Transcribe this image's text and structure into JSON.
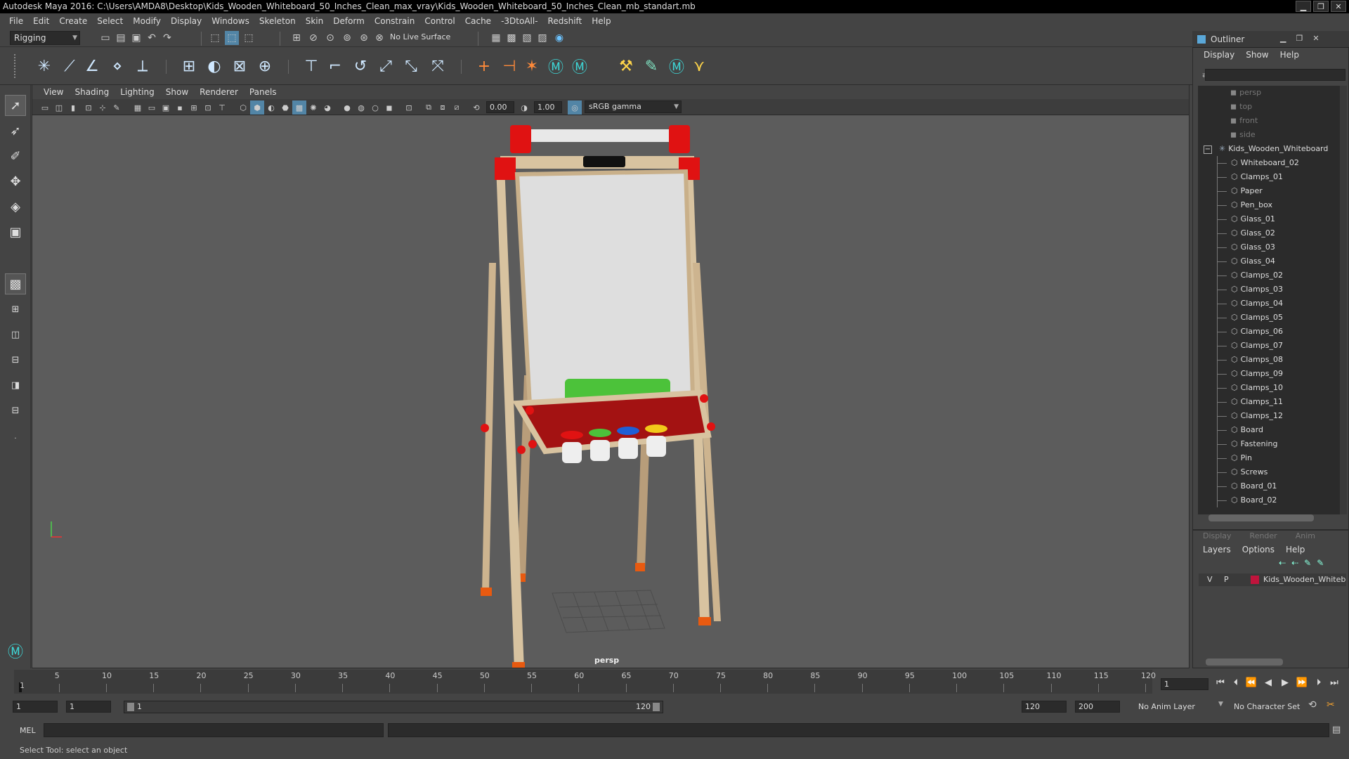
{
  "window": {
    "title": "Autodesk Maya 2016: C:\\Users\\AMDA8\\Desktop\\Kids_Wooden_Whiteboard_50_Inches_Clean_max_vray\\Kids_Wooden_Whiteboard_50_Inches_Clean_mb_standart.mb",
    "minimize": "▁",
    "restore": "❐",
    "close": "✕"
  },
  "menubar": [
    "File",
    "Edit",
    "Create",
    "Select",
    "Modify",
    "Display",
    "Windows",
    "Skeleton",
    "Skin",
    "Deform",
    "Constrain",
    "Control",
    "Cache",
    "-3DtoAll-",
    "Redshift",
    "Help"
  ],
  "statusline": {
    "menuset": "Rigging",
    "live_surface": "No Live Surface"
  },
  "panel": {
    "menus": [
      "View",
      "Shading",
      "Lighting",
      "Show",
      "Renderer",
      "Panels"
    ],
    "field_a": "0.00",
    "field_b": "1.00",
    "colorspace": "sRGB gamma",
    "camera": "persp"
  },
  "outliner": {
    "title": "Outliner",
    "menus": [
      "Display",
      "Show",
      "Help"
    ],
    "cameras": [
      "persp",
      "top",
      "front",
      "side"
    ],
    "group": "Kids_Wooden_Whiteboard",
    "collapse_glyph": "−",
    "items": [
      "Whiteboard_02",
      "Clamps_01",
      "Paper",
      "Pen_box",
      "Glass_01",
      "Glass_02",
      "Glass_03",
      "Glass_04",
      "Clamps_02",
      "Clamps_03",
      "Clamps_04",
      "Clamps_05",
      "Clamps_06",
      "Clamps_07",
      "Clamps_08",
      "Clamps_09",
      "Clamps_10",
      "Clamps_11",
      "Clamps_12",
      "Board",
      "Fastening",
      "Pin",
      "Screws",
      "Board_01",
      "Board_02"
    ]
  },
  "layers": {
    "tabs": [
      "Display",
      "Render",
      "Anim"
    ],
    "menus": [
      "Layers",
      "Options",
      "Help"
    ],
    "v": "V",
    "p": "P",
    "layer_name": "Kids_Wooden_Whiteb",
    "layer_color": "#c0143c"
  },
  "timeline": {
    "ticks": [
      "5",
      "10",
      "15",
      "20",
      "25",
      "30",
      "35",
      "40",
      "45",
      "50",
      "55",
      "60",
      "65",
      "70",
      "75",
      "80",
      "85",
      "90",
      "95",
      "100",
      "105",
      "110",
      "115",
      "120"
    ],
    "first_tick": "1",
    "current_frame": "1"
  },
  "range": {
    "start": "1",
    "anim_start": "1",
    "slider_start": "1",
    "slider_end": "120",
    "end": "120",
    "anim_end": "200",
    "anim_layer": "No Anim Layer",
    "char_set": "No Character Set"
  },
  "cmdline": {
    "label": "MEL"
  },
  "helpline": {
    "text": "Select Tool: select an object"
  },
  "colors": {
    "accent": "#5285a6",
    "viewport_bg": "#5c5c5c"
  }
}
